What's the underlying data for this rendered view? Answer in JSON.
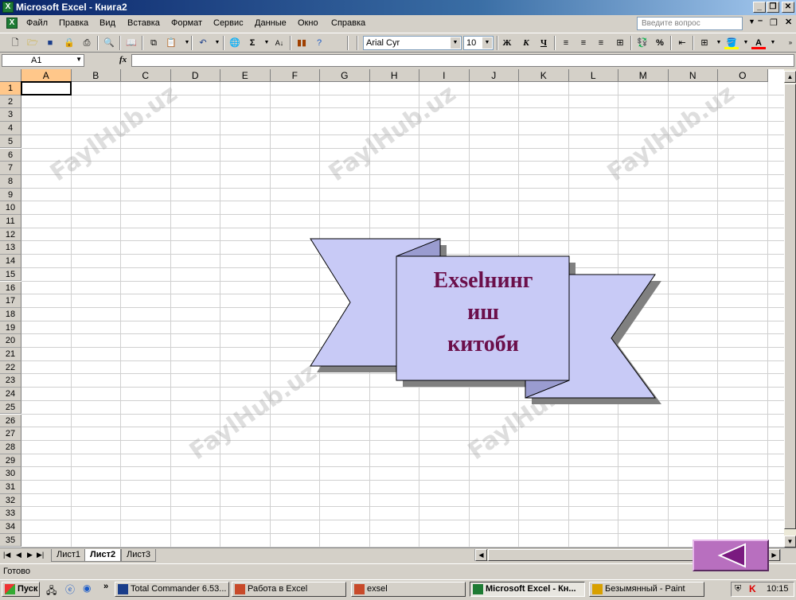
{
  "window": {
    "title": "Microsoft Excel - Книга2",
    "app_icon": "excel-icon",
    "controls": [
      "_",
      "❐",
      "✕"
    ]
  },
  "menubar": {
    "items": [
      {
        "label": "Файл"
      },
      {
        "label": "Правка"
      },
      {
        "label": "Вид"
      },
      {
        "label": "Вставка"
      },
      {
        "label": "Формат"
      },
      {
        "label": "Сервис"
      },
      {
        "label": "Данные"
      },
      {
        "label": "Окно"
      },
      {
        "label": "Справка"
      }
    ],
    "ask_placeholder": "Введите вопрос"
  },
  "toolbar": {
    "font_name": "Arial Cyr",
    "font_size": "10",
    "bold": "Ж",
    "italic": "К",
    "underline": "Ч",
    "sum": "Σ",
    "percent": "%",
    "font_color_letter": "A"
  },
  "formula_bar": {
    "name_box": "A1",
    "fx": "fx",
    "value": ""
  },
  "sheet": {
    "columns": [
      "A",
      "B",
      "C",
      "D",
      "E",
      "F",
      "G",
      "H",
      "I",
      "J",
      "K",
      "L",
      "M",
      "N",
      "O"
    ],
    "rows": [
      "1",
      "2",
      "3",
      "4",
      "5",
      "6",
      "7",
      "8",
      "9",
      "10",
      "11",
      "12",
      "13",
      "14",
      "15",
      "16",
      "17",
      "18",
      "19",
      "20",
      "21",
      "22",
      "23",
      "24",
      "25",
      "26",
      "27",
      "28",
      "29",
      "30",
      "31",
      "32",
      "33",
      "34",
      "35"
    ],
    "selected_cell": "A1"
  },
  "banner": {
    "line1": "Exselнинг",
    "line2": "иш",
    "line3": "китоби",
    "fill": "#c8caf6",
    "text_color": "#6b0f4a"
  },
  "watermark": "FaylHub.uz",
  "tabs": {
    "items": [
      {
        "label": "Лист1"
      },
      {
        "label": "Лист2"
      },
      {
        "label": "Лист3"
      }
    ],
    "active": "Лист2"
  },
  "status": {
    "text": "Готово"
  },
  "taskbar": {
    "start": "Пуск",
    "tasks": [
      {
        "label": "Total Commander 6.53..."
      },
      {
        "label": "Работа в Excel"
      },
      {
        "label": "exsel"
      },
      {
        "label": "Microsoft Excel - Кн..."
      },
      {
        "label": "Безымянный - Paint"
      }
    ],
    "clock": "10:15"
  },
  "colors": {
    "titlebar_start": "#0a246a",
    "back_button": "#b86fbf",
    "back_arrow": "#7a1a80"
  }
}
